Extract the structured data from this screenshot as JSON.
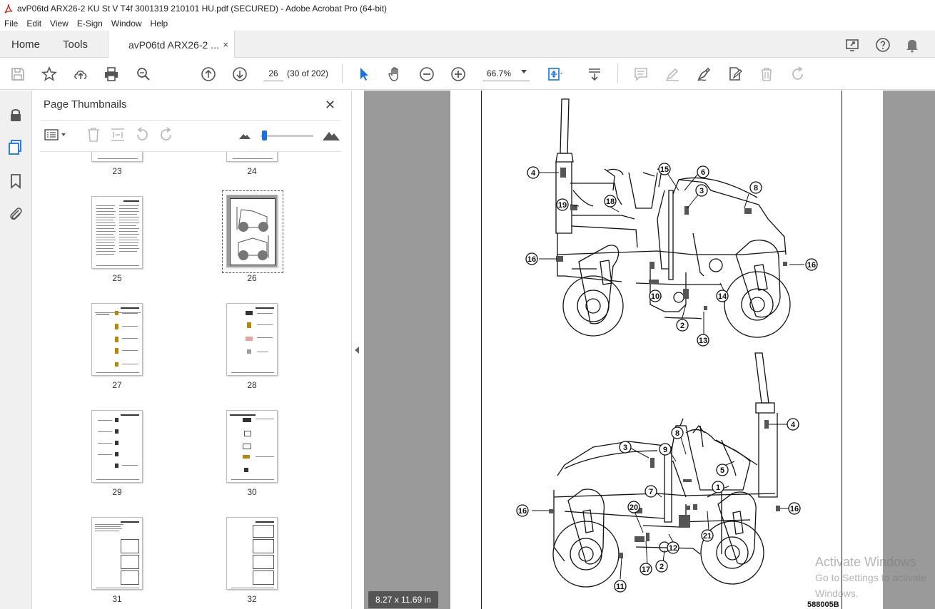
{
  "window": {
    "title": "avP06td ARX26-2 KU St V T4f 3001319 210101 HU.pdf (SECURED) - Adobe Acrobat Pro (64-bit)"
  },
  "menu": [
    "File",
    "Edit",
    "View",
    "E-Sign",
    "Window",
    "Help"
  ],
  "tabs": {
    "home": "Home",
    "tools": "Tools",
    "document": "avP06td ARX26-2 ...",
    "close": "×"
  },
  "toolbar": {
    "page_number": "26",
    "page_count": "(30 of 202)",
    "zoom": "66.7%"
  },
  "panel": {
    "title": "Page Thumbnails",
    "close": "✕",
    "thumbnails": [
      {
        "label": "23"
      },
      {
        "label": "24"
      },
      {
        "label": "25"
      },
      {
        "label": "26"
      },
      {
        "label": "27"
      },
      {
        "label": "28"
      },
      {
        "label": "29"
      },
      {
        "label": "30"
      },
      {
        "label": "31"
      },
      {
        "label": "32"
      }
    ]
  },
  "document_view": {
    "callouts_top": [
      "4",
      "15",
      "6",
      "3",
      "8",
      "19",
      "18",
      "16",
      "16",
      "10",
      "14",
      "2",
      "13"
    ],
    "callouts_bottom": [
      "4",
      "3",
      "9",
      "8",
      "5",
      "1",
      "7",
      "16",
      "20",
      "16",
      "21",
      "12",
      "2",
      "17",
      "11"
    ],
    "figure_code": "588005B",
    "page_size": "8.27 x 11.69 in"
  },
  "watermark": {
    "line1": "Activate Windows",
    "line2": "Go to Settings to activate Windows."
  }
}
